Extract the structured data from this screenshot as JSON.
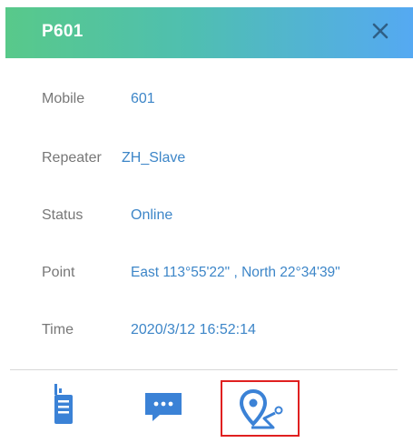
{
  "header": {
    "title": "P601",
    "close_icon": "close-icon"
  },
  "details": {
    "mobile": {
      "label": "Mobile",
      "value": "601"
    },
    "repeater": {
      "label": "Repeater",
      "value": "ZH_Slave"
    },
    "status": {
      "label": "Status",
      "value": "Online"
    },
    "point": {
      "label": "Point",
      "value": "East 113°55'22\" , North 22°34'39\""
    },
    "time": {
      "label": "Time",
      "value": "2020/3/12 16:52:14"
    }
  },
  "actions": [
    {
      "icon": "radio-icon"
    },
    {
      "icon": "message-icon"
    },
    {
      "icon": "location-track-icon",
      "selected": true
    }
  ],
  "colors": {
    "accent": "#3b82d6",
    "label": "#777777",
    "value": "#3d86c8",
    "highlight": "#e02020",
    "header_gradient_start": "#58c98a",
    "header_gradient_end": "#55a9f2"
  }
}
